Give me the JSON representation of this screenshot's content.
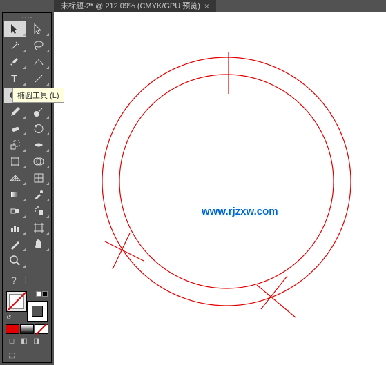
{
  "tab": {
    "title": "未标题-2* @ 212.09% (CMYK/GPU 预览)",
    "close": "×"
  },
  "tooltip": "椭圆工具 (L)",
  "tools": {
    "selection": "selection",
    "direct": "direct-selection",
    "wand": "magic-wand",
    "lasso": "lasso",
    "pen": "pen",
    "curvature": "curvature-pen",
    "type": "type",
    "line": "line-segment",
    "ellipse": "ellipse",
    "brush": "paintbrush",
    "pencil": "pencil",
    "blob": "blob-brush",
    "eraser": "eraser",
    "rotate": "rotate",
    "scale": "scale",
    "width": "width",
    "free": "free-transform",
    "shape": "shape-builder",
    "persp": "perspective-grid",
    "mesh": "mesh",
    "grad": "gradient",
    "eyedrop": "eyedropper",
    "blend": "blend",
    "symbol": "symbol-sprayer",
    "graph": "column-graph",
    "artb": "artboard",
    "slice": "slice",
    "hand": "hand",
    "zoom": "zoom"
  },
  "help": "?",
  "colors": {
    "red": "#e30000",
    "white": "#ffffff",
    "black": "#000000",
    "none": "none"
  },
  "watermark": "www.rjzxw.com",
  "chart_data": null
}
